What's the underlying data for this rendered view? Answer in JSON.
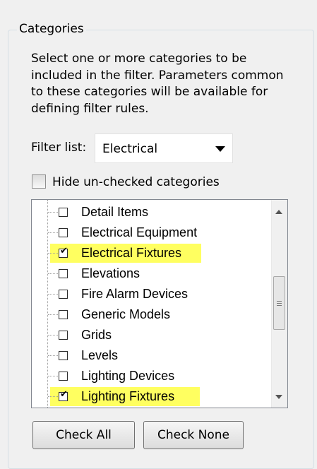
{
  "group_title": "Categories",
  "description": "Select one or more categories to be included in the filter.  Parameters common to these categories will be available for defining filter rules.",
  "filter_list": {
    "label": "Filter list:",
    "value": "Electrical"
  },
  "hide_unchecked": {
    "label": "Hide un-checked categories",
    "checked": false
  },
  "categories": [
    {
      "label": "Detail Items",
      "checked": false,
      "highlighted": false
    },
    {
      "label": "Electrical Equipment",
      "checked": false,
      "highlighted": false
    },
    {
      "label": "Electrical Fixtures",
      "checked": true,
      "highlighted": true
    },
    {
      "label": "Elevations",
      "checked": false,
      "highlighted": false
    },
    {
      "label": "Fire Alarm Devices",
      "checked": false,
      "highlighted": false
    },
    {
      "label": "Generic Models",
      "checked": false,
      "highlighted": false
    },
    {
      "label": "Grids",
      "checked": false,
      "highlighted": false
    },
    {
      "label": "Levels",
      "checked": false,
      "highlighted": false
    },
    {
      "label": "Lighting Devices",
      "checked": false,
      "highlighted": false
    },
    {
      "label": "Lighting Fixtures",
      "checked": true,
      "highlighted": true
    }
  ],
  "buttons": {
    "check_all": "Check All",
    "check_none": "Check None"
  },
  "colors": {
    "highlight": "#ffff33",
    "background": "#f0f0f0"
  }
}
